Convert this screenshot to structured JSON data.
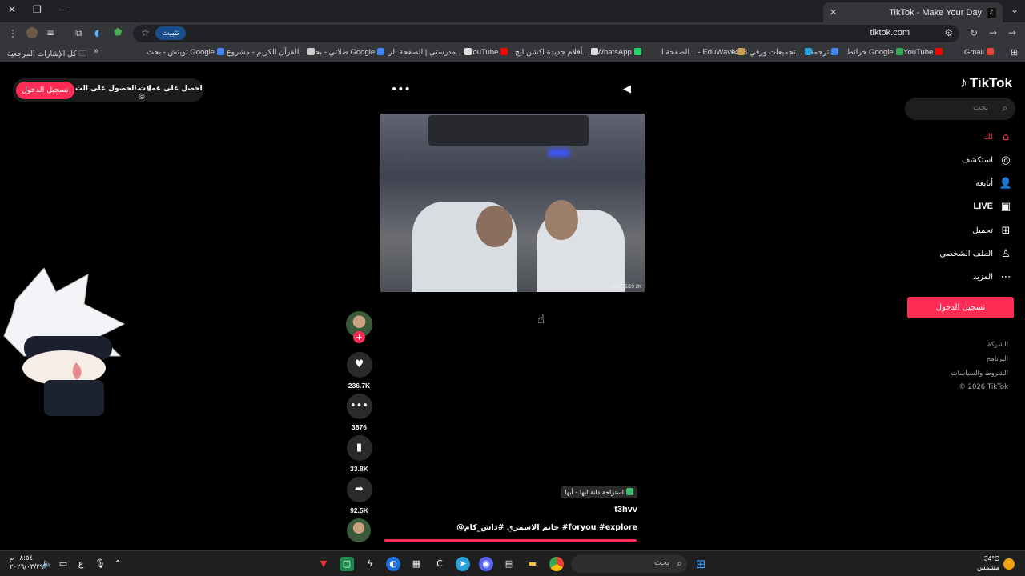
{
  "browser": {
    "tab_title": "TikTok - Make Your Day",
    "url": "tiktok.com",
    "install_label": "تثبيت",
    "bookmarks": [
      {
        "label": "Gmail",
        "color": "#ea4335"
      },
      {
        "label": "YouTube",
        "color": "#ff0000"
      },
      {
        "label": "خرائط Google",
        "color": "#34a853"
      },
      {
        "label": "ترجمة",
        "color": "#4285f4"
      },
      {
        "label": "تجميعات ورقي 1443...",
        "color": "#2aa1da"
      },
      {
        "label": "الصفحة ا... - EduWave",
        "color": "#c8a04a"
      },
      {
        "label": "WhatsApp",
        "color": "#25d366"
      },
      {
        "label": "أفلام جديدة اكشن ايج...",
        "color": "#dddddd"
      },
      {
        "label": "YouTube",
        "color": "#ff0000"
      },
      {
        "label": "مدرستي | الصفحة الر...",
        "color": "#e0e0e0"
      },
      {
        "label": "صلاتي - بحث Google",
        "color": "#4285f4"
      },
      {
        "label": "القرآن الكريم - مشروع...",
        "color": "#cccccc"
      },
      {
        "label": "تويتش - بحث Google",
        "color": "#4285f4"
      }
    ],
    "all_bookmarks": "كل الإشارات المرجعية",
    "overflow": "»"
  },
  "tiktok": {
    "logo": "TikTok",
    "search_placeholder": "بحث",
    "nav": [
      {
        "label": "لك",
        "icon": "home-icon",
        "glyph": "⌂",
        "active": true
      },
      {
        "label": "استكشف",
        "icon": "compass-icon",
        "glyph": "◎"
      },
      {
        "label": "أتابعه",
        "icon": "following-icon",
        "glyph": "👤"
      },
      {
        "label": "LIVE",
        "icon": "live-icon",
        "glyph": "▣"
      },
      {
        "label": "تحميل",
        "icon": "upload-icon",
        "glyph": "⊞"
      },
      {
        "label": "الملف الشخصي",
        "icon": "profile-icon",
        "glyph": "♙"
      },
      {
        "label": "المزيد",
        "icon": "more-icon",
        "glyph": "⋯"
      }
    ],
    "login_button": "تسجيل الدخول",
    "footer": [
      "الشركة",
      "البرنامج",
      "الشروط والسياسات",
      "© 2026 TikTok"
    ],
    "top_actions": {
      "coins": "احصل على عملات",
      "app": "الحصول على الت...",
      "login": "تسجيل الدخول"
    },
    "video": {
      "timestamp": "2026/05/23 2K",
      "location": "استراحة دانة ابها - أبها",
      "username": "t3hvv",
      "caption": "@حاتم الاسمري #داش_كام #foryou #explore",
      "progress": 0.98
    },
    "actions": {
      "likes": "236.7K",
      "comments": "3876",
      "saves": "33.8K",
      "shares": "92.5K"
    }
  },
  "taskbar": {
    "search_placeholder": "بحث",
    "weather_temp": "34°C",
    "weather_desc": "مشمس",
    "time": "٠٨:٥٤ م",
    "date": "٢٠٢٦/٠٣/٢٩",
    "lang": "ع"
  }
}
